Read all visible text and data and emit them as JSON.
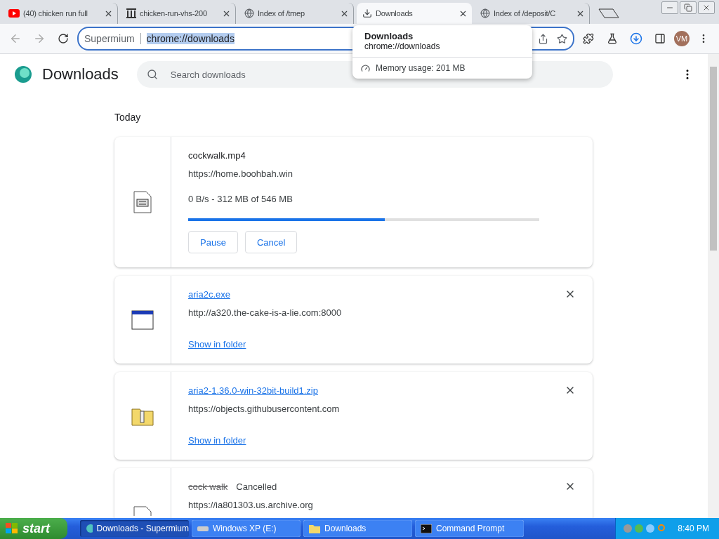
{
  "tabs": [
    {
      "kind": "youtube",
      "title": "(40) chicken run full",
      "selected": false
    },
    {
      "kind": "archive",
      "title": "chicken-run-vhs-200",
      "selected": false
    },
    {
      "kind": "globe",
      "title": "Index of /tmep",
      "selected": false
    },
    {
      "kind": "download",
      "title": "Downloads",
      "selected": true
    },
    {
      "kind": "globe",
      "title": "Index of /deposit/C",
      "selected": false
    }
  ],
  "toolbar": {
    "site_label": "Supermium",
    "url": "chrome://downloads",
    "profile": "VM"
  },
  "tab_tooltip": {
    "title": "Downloads",
    "url": "chrome://downloads",
    "memory": "Memory usage: 201 MB"
  },
  "page": {
    "title": "Downloads",
    "search_placeholder": "Search downloads",
    "section": "Today",
    "downloads": [
      {
        "kind": "in_progress",
        "name": "cockwalk.mp4",
        "url": "https://home.boohbah.win",
        "status": "0 B/s - 312 MB of 546 MB",
        "level": 0.56,
        "buttons": [
          "Pause",
          "Cancel"
        ]
      },
      {
        "kind": "complete",
        "name": "aria2c.exe",
        "url": "http://a320.the-cake-is-a-lie.com:8000",
        "link": "Show in folder"
      },
      {
        "kind": "complete",
        "name": "aria2-1.36.0-win-32bit-build1.zip",
        "url": "https://objects.githubusercontent.com",
        "link": "Show in folder"
      },
      {
        "kind": "cancelled",
        "name": "cock walk",
        "status": "Cancelled",
        "url": "https://ia801303.us.archive.org"
      }
    ]
  },
  "taskbar": {
    "start": "start",
    "tasks": [
      {
        "kind": "browser",
        "label": "Downloads - Supermium",
        "selected": true
      },
      {
        "kind": "drive",
        "label": "Windows XP (E:)",
        "selected": false
      },
      {
        "kind": "folder",
        "label": "Downloads",
        "selected": false
      },
      {
        "kind": "console",
        "label": "Command Prompt",
        "selected": false
      }
    ],
    "clock": "8:40 PM"
  }
}
